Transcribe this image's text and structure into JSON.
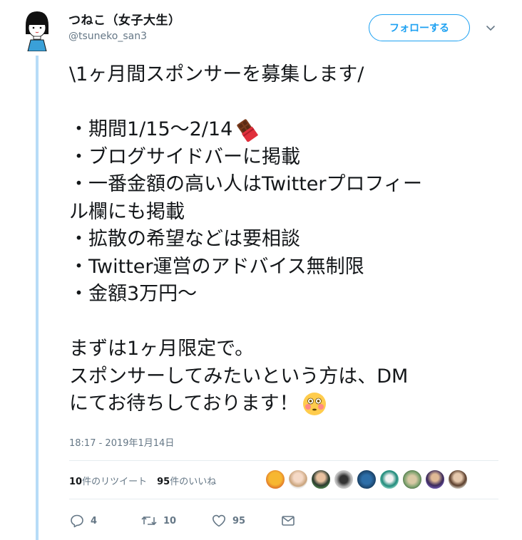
{
  "user": {
    "display_name": "つねこ（女子大生）",
    "screen_name": "@tsuneko_san3"
  },
  "follow_label": "フォローする",
  "tweet": {
    "lines": [
      "\\1ヶ月間スポンサーを募集します/",
      "",
      "・期間1/15〜2/14",
      "・ブログサイドバーに掲載",
      "・一番金額の高い人はTwitterプロフィー",
      "ル欄にも掲載",
      "・拡散の希望などは要相談",
      "・Twitter運営のアドバイス無制限",
      "・金額3万円〜",
      "",
      "まずは1ヶ月限定で。",
      "スポンサーしてみたいという方は、DM",
      "にてお待ちしております！"
    ],
    "emojis": [
      "chocolate-bar-emoji",
      "flushed-face-emoji"
    ]
  },
  "timestamp": "18:17 - 2019年1月14日",
  "stats": {
    "retweets_count": "10",
    "retweets_label": "件のリツイート",
    "likes_count": "95",
    "likes_label": "件のいいね"
  },
  "actions": {
    "reply_count": "4",
    "retweet_count": "10",
    "like_count": "95"
  },
  "colors": {
    "accent": "#1da1f2",
    "thread_line": "#b7dcf7",
    "muted_text": "#657786"
  }
}
